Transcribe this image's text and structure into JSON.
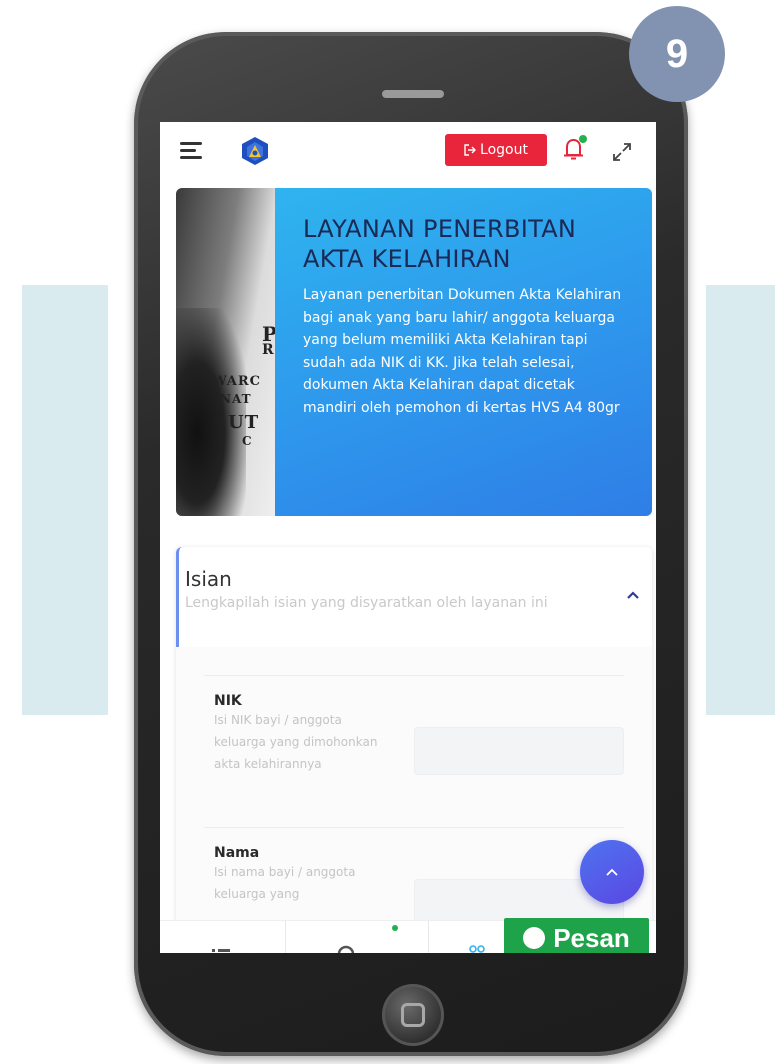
{
  "step": {
    "number": "9"
  },
  "topbar": {
    "logout_label": "Logout",
    "icons": [
      "hamburger-menu-icon",
      "logo-icon",
      "logout-icon",
      "bell-icon",
      "expand-icon"
    ]
  },
  "hero": {
    "title": "LAYANAN PENERBITAN AKTA KELAHIRAN",
    "description": "Layanan penerbitan Dokumen Akta Kelahiran bagi anak yang baru lahir/ anggota keluarga yang belum memiliki Akta Kelahiran tapi sudah ada NIK di KK. Jika telah selesai, dokumen Akta Kelahiran dapat dicetak mandiri oleh pemohon di kertas HVS A4 80gr"
  },
  "form": {
    "title": "Isian",
    "subtitle": "Lengkapilah isian yang disyaratkan oleh layanan ini",
    "fields": [
      {
        "label": "NIK",
        "help": "Isi NIK bayi / anggota keluarga yang dimohonkan akta kelahirannya",
        "value": ""
      },
      {
        "label": "Nama",
        "help": "Isi nama bayi / anggota keluarga yang",
        "value": ""
      }
    ]
  },
  "bottom_nav": {
    "pesan_label": "Pesan"
  },
  "colors": {
    "logout": "#e8253b",
    "hero_blue": "#2e96ec",
    "hero_title": "#1a2a55",
    "fab": "#5a5ce8",
    "pesan": "#1fa34a",
    "badge": "#8193b1",
    "side_panel": "#d9ebee"
  }
}
